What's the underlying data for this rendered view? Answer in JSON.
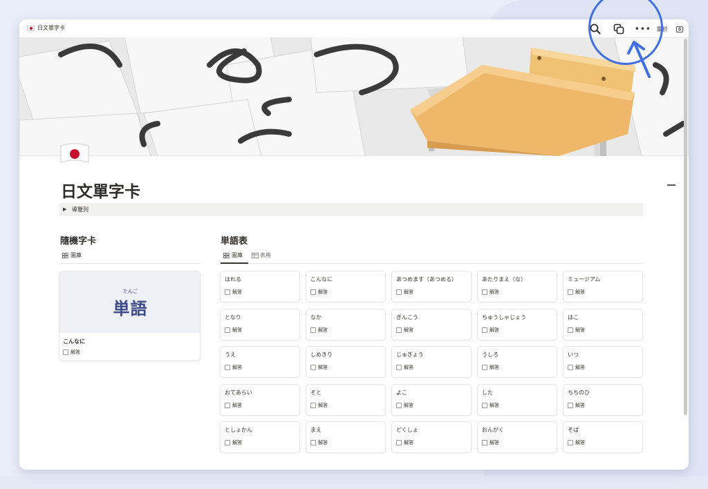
{
  "window": {
    "tab_title": "日文單字卡",
    "more_label": "•••",
    "about_label": "關於",
    "box_glyph": "⧉"
  },
  "page": {
    "title": "日文單字卡",
    "toggle_label": "導覽列"
  },
  "random_section": {
    "title": "隨機字卡",
    "view_label": "圖庫",
    "card": {
      "ruby": "たんご",
      "word": "単語",
      "name": "こんなに",
      "checkbox_label": "解答"
    }
  },
  "vocab_section": {
    "title": "単語表",
    "views": [
      "圖庫",
      "表格"
    ],
    "checkbox_label": "解答",
    "rows": [
      [
        "はれる",
        "こんなに",
        "あつめます（あつめる）",
        "あたりまえ（な）",
        "ミュージアム"
      ],
      [
        "となり",
        "なか",
        "ぎんこう",
        "ちゅうしゃじょう",
        "はこ"
      ],
      [
        "うえ",
        "しめきり",
        "じゅぎょう",
        "うしろ",
        "いつ"
      ],
      [
        "おてあらい",
        "そと",
        "よこ",
        "した",
        "ちちのひ"
      ],
      [
        "としょかん",
        "まえ",
        "どくしょ",
        "おんがく",
        "そば"
      ]
    ]
  },
  "colors": {
    "accent": "#3f6fe0",
    "card_word": "#3d4a8a",
    "toggle_bg": "#f1f1ef"
  },
  "icons": [
    "search-icon",
    "duplicate-icon",
    "more-icon",
    "caret-right-icon",
    "gallery-icon",
    "table-icon",
    "checkbox-icon"
  ]
}
